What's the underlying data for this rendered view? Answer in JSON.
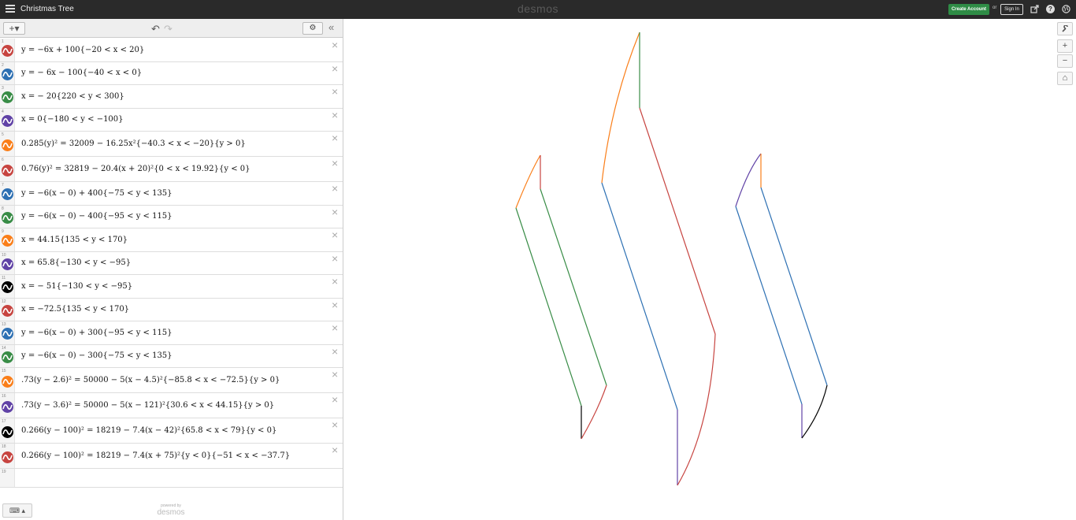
{
  "topbar": {
    "graph_title": "Christmas Tree",
    "brand": "desmos",
    "create_account_label": "Create Account",
    "or_text": "or",
    "sign_in_label": "Sign In",
    "help_glyph": "?"
  },
  "toolbar": {
    "add_label": "+▾",
    "undo_glyph": "↶",
    "redo_glyph": "↷",
    "settings_glyph": "⚙",
    "collapse_glyph": "«"
  },
  "expressions": [
    {
      "index": "1",
      "color": "#c74440",
      "latex": "y = −6x + 100{−20 < x < 20}"
    },
    {
      "index": "2",
      "color": "#2d70b3",
      "latex": "y =  − 6x − 100{−40 < x < 0}"
    },
    {
      "index": "3",
      "color": "#388c46",
      "latex": "x =  − 20{220 < y < 300}"
    },
    {
      "index": "4",
      "color": "#6042a6",
      "latex": "x = 0{−180 < y < −100}"
    },
    {
      "index": "5",
      "color": "#fa7e19",
      "latex": "0.285(y)² = 32009 − 16.25x²{−40.3 < x < −20}{y > 0}"
    },
    {
      "index": "6",
      "color": "#c74440",
      "latex": "0.76(y)² = 32819 − 20.4(x + 20)²{0 < x < 19.92}{y < 0}"
    },
    {
      "index": "7",
      "color": "#2d70b3",
      "latex": "y = −6(x − 0) + 400{−75 < y < 135}"
    },
    {
      "index": "8",
      "color": "#388c46",
      "latex": "y = −6(x − 0) − 400{−95 < y < 115}"
    },
    {
      "index": "9",
      "color": "#fa7e19",
      "latex": "x = 44.15{135 < y < 170}"
    },
    {
      "index": "10",
      "color": "#6042a6",
      "latex": "x = 65.8{−130 < y < −95}"
    },
    {
      "index": "11",
      "color": "#000000",
      "latex": "x =  − 51{−130 < y < −95}"
    },
    {
      "index": "12",
      "color": "#c74440",
      "latex": "x = −72.5{135 < y < 170}"
    },
    {
      "index": "13",
      "color": "#2d70b3",
      "latex": "y = −6(x − 0) + 300{−95 < y < 115}"
    },
    {
      "index": "14",
      "color": "#388c46",
      "latex": "y = −6(x − 0) − 300{−75 < y < 135}"
    },
    {
      "index": "15",
      "color": "#fa7e19",
      "latex": ".73(y − 2.6)² = 50000 − 5(x − 4.5)²{−85.8 < x < −72.5}{y > 0}"
    },
    {
      "index": "16",
      "color": "#6042a6",
      "latex": ".73(y − 3.6)² = 50000 − 5(x − 121)²{30.6 < x < 44.15}{y > 0}"
    },
    {
      "index": "17",
      "color": "#000000",
      "latex": "0.266(y − 100)² = 18219 − 7.4(x − 42)²{65.8 < x < 79}{y < 0}"
    },
    {
      "index": "18",
      "color": "#c74440",
      "latex": "0.266(y − 100)² = 18219 − 7.4(x + 75)²{y < 0}{−51 < x < −37.7}"
    },
    {
      "index": "19",
      "color": "",
      "latex": ""
    }
  ],
  "footer": {
    "keyboard_glyph": "⌨ ▴",
    "powered_by": "powered by",
    "powered_brand": "desmos"
  },
  "graph_controls": {
    "wrench_glyph": "🔧",
    "zoom_in_glyph": "+",
    "zoom_out_glyph": "−",
    "home_glyph": "⌂"
  },
  "colors": {
    "red": "#c74440",
    "blue": "#2d70b3",
    "green": "#388c46",
    "purple": "#6042a6",
    "orange": "#fa7e19",
    "black": "#000000",
    "topbar": "#2a2a2a",
    "create_account": "#2f8c46"
  }
}
